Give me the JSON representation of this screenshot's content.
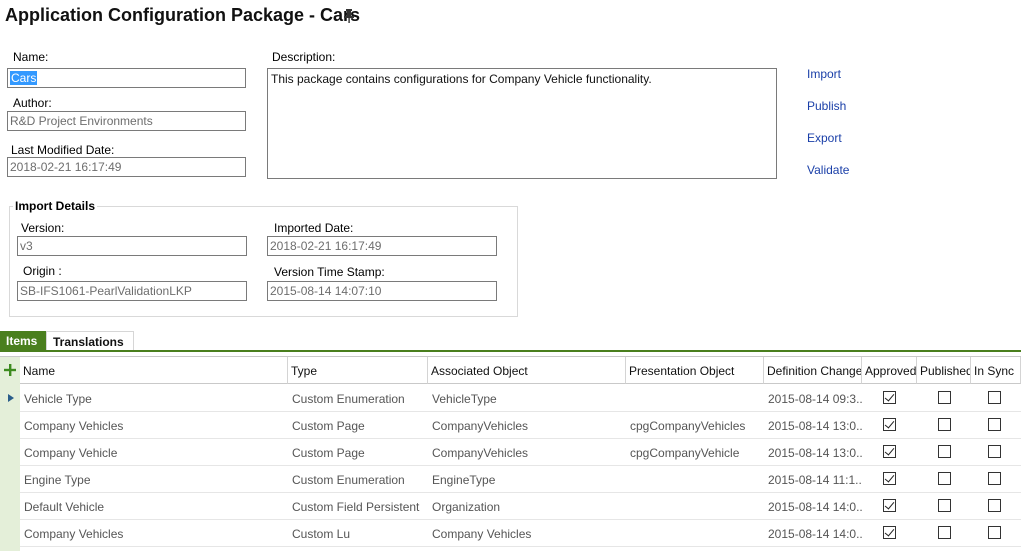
{
  "title": "Application Configuration Package - Cars",
  "form": {
    "name_label": "Name:",
    "name_value": "Cars",
    "author_label": "Author:",
    "author_value": "R&D Project Environments",
    "modified_label": "Last Modified Date:",
    "modified_value": "2018-02-21 16:17:49",
    "description_label": "Description:",
    "description_value": "This package contains configurations for Company Vehicle functionality."
  },
  "actions": [
    "Import",
    "Publish",
    "Export",
    "Validate"
  ],
  "import_details": {
    "title": "Import Details",
    "version_label": "Version:",
    "version_value": "v3",
    "origin_label": "Origin :",
    "origin_value": "SB-IFS1061-PearlValidationLKP",
    "imported_label": "Imported Date:",
    "imported_value": "2018-02-21 16:17:49",
    "timestamp_label": "Version Time Stamp:",
    "timestamp_value": "2015-08-14 14:07:10"
  },
  "tabs": [
    "Items",
    "Translations"
  ],
  "table": {
    "columns": [
      "Name",
      "Type",
      "Associated Object",
      "Presentation Object",
      "Definition Changed",
      "Approved",
      "Published",
      "In Sync"
    ],
    "rows": [
      {
        "name": "Vehicle Type",
        "type": "Custom Enumeration",
        "assoc": "VehicleType",
        "pres": "",
        "changed": "2015-08-14 09:3...",
        "approved": true,
        "published": false,
        "insync": false
      },
      {
        "name": "Company Vehicles",
        "type": "Custom Page",
        "assoc": "CompanyVehicles",
        "pres": "cpgCompanyVehicles",
        "changed": "2015-08-14 13:0...",
        "approved": true,
        "published": false,
        "insync": false
      },
      {
        "name": "Company Vehicle",
        "type": "Custom Page",
        "assoc": "CompanyVehicles",
        "pres": "cpgCompanyVehicle",
        "changed": "2015-08-14 13:0...",
        "approved": true,
        "published": false,
        "insync": false
      },
      {
        "name": "Engine Type",
        "type": "Custom Enumeration",
        "assoc": "EngineType",
        "pres": "",
        "changed": "2015-08-14 11:1...",
        "approved": true,
        "published": false,
        "insync": false
      },
      {
        "name": "Default Vehicle",
        "type": "Custom Field Persistent",
        "assoc": "Organization",
        "pres": "",
        "changed": "2015-08-14 14:0...",
        "approved": true,
        "published": false,
        "insync": false
      },
      {
        "name": "Company Vehicles",
        "type": "Custom Lu",
        "assoc": "Company Vehicles",
        "pres": "",
        "changed": "2015-08-14 14:0...",
        "approved": true,
        "published": false,
        "insync": false
      }
    ]
  },
  "icons": {
    "pin": "pin-icon",
    "add": "add-row-icon",
    "current_row": "row-indicator-icon"
  },
  "colors": {
    "accent_green": "#4a7f1e",
    "link_blue": "#1a3fa8",
    "selection_blue": "#3399ff"
  }
}
